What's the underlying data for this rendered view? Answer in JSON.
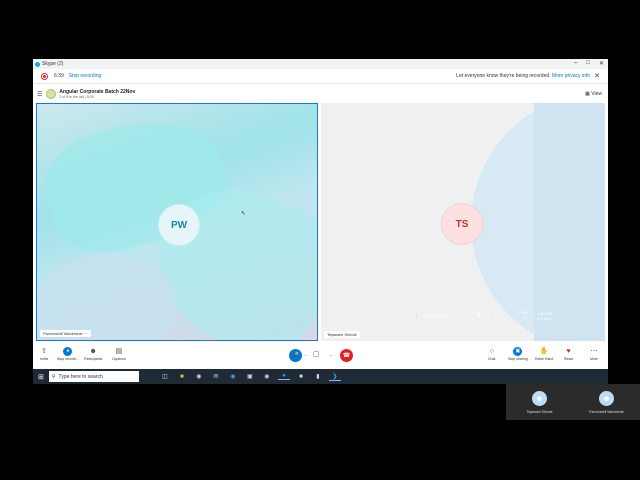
{
  "window": {
    "title": "Skype (2)"
  },
  "recording": {
    "time": "6:39",
    "stop_label": "Stop recording",
    "notice": "Let everyone know they're being recorded.",
    "more_link": "More privacy info"
  },
  "meeting": {
    "title": "Angular Corporate Batch 22Nov",
    "subtitle": "2 of 8 in the call | 8:05",
    "view_label": "View"
  },
  "tiles": [
    {
      "initials": "PW",
      "name": "Panchashil Wankhede",
      "name_suffix": "···",
      "color": "#178a9e"
    },
    {
      "initials": "TS",
      "name": "Tejaswini Shinde",
      "color": "#c7342e"
    }
  ],
  "controls": {
    "left": [
      {
        "label": "Invite",
        "icon": "share-icon"
      },
      {
        "label": "Stop recordi...",
        "icon": "record-icon"
      },
      {
        "label": "Participants",
        "icon": "people-icon"
      },
      {
        "label": "Captions",
        "icon": "captions-icon"
      }
    ],
    "right": [
      {
        "label": "Chat",
        "icon": "chat-icon"
      },
      {
        "label": "Stop sharing",
        "icon": "share-screen-icon"
      },
      {
        "label": "Raise Hand",
        "icon": "hand-icon"
      },
      {
        "label": "React",
        "icon": "heart-icon"
      },
      {
        "label": "More",
        "icon": "more-icon"
      }
    ]
  },
  "taskbar": {
    "search_placeholder": "Type here to search",
    "weather": "22°C  Clear",
    "language_top": "ENG",
    "language_bottom": "IN",
    "time": "7:50 PM",
    "date": "2/2/2023"
  },
  "mini_window": {
    "participants": [
      "Tejaswini Shinde",
      "Panchashil Wankhede"
    ]
  }
}
